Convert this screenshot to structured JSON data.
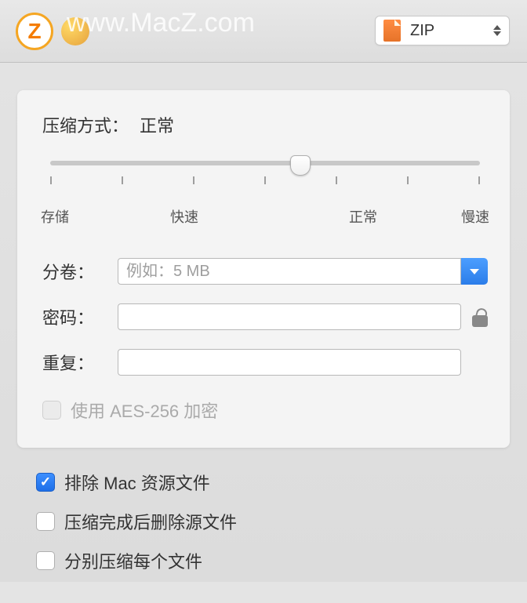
{
  "header": {
    "watermark": "www.MacZ.com",
    "format": "ZIP",
    "app_letter": "Z"
  },
  "panel": {
    "compression_label": "压缩方式：",
    "compression_value": "正常",
    "slider_labels": {
      "store": "存储",
      "fast": "快速",
      "normal": "正常",
      "slow": "慢速"
    },
    "split_label": "分卷：",
    "split_placeholder": "例如：5 MB",
    "password_label": "密码：",
    "repeat_label": "重复：",
    "aes_label": "使用 AES-256 加密"
  },
  "options": {
    "exclude_mac": "排除 Mac 资源文件",
    "delete_after": "压缩完成后删除源文件",
    "compress_individually": "分别压缩每个文件"
  }
}
